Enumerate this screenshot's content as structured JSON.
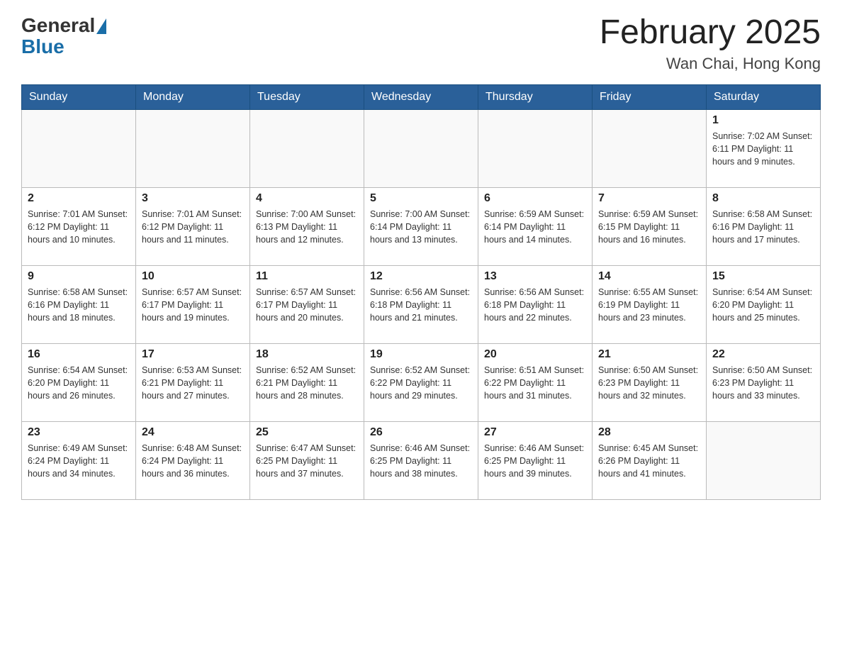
{
  "logo": {
    "general": "General",
    "blue": "Blue"
  },
  "title": "February 2025",
  "location": "Wan Chai, Hong Kong",
  "weekdays": [
    "Sunday",
    "Monday",
    "Tuesday",
    "Wednesday",
    "Thursday",
    "Friday",
    "Saturday"
  ],
  "weeks": [
    [
      {
        "day": "",
        "info": ""
      },
      {
        "day": "",
        "info": ""
      },
      {
        "day": "",
        "info": ""
      },
      {
        "day": "",
        "info": ""
      },
      {
        "day": "",
        "info": ""
      },
      {
        "day": "",
        "info": ""
      },
      {
        "day": "1",
        "info": "Sunrise: 7:02 AM\nSunset: 6:11 PM\nDaylight: 11 hours\nand 9 minutes."
      }
    ],
    [
      {
        "day": "2",
        "info": "Sunrise: 7:01 AM\nSunset: 6:12 PM\nDaylight: 11 hours\nand 10 minutes."
      },
      {
        "day": "3",
        "info": "Sunrise: 7:01 AM\nSunset: 6:12 PM\nDaylight: 11 hours\nand 11 minutes."
      },
      {
        "day": "4",
        "info": "Sunrise: 7:00 AM\nSunset: 6:13 PM\nDaylight: 11 hours\nand 12 minutes."
      },
      {
        "day": "5",
        "info": "Sunrise: 7:00 AM\nSunset: 6:14 PM\nDaylight: 11 hours\nand 13 minutes."
      },
      {
        "day": "6",
        "info": "Sunrise: 6:59 AM\nSunset: 6:14 PM\nDaylight: 11 hours\nand 14 minutes."
      },
      {
        "day": "7",
        "info": "Sunrise: 6:59 AM\nSunset: 6:15 PM\nDaylight: 11 hours\nand 16 minutes."
      },
      {
        "day": "8",
        "info": "Sunrise: 6:58 AM\nSunset: 6:16 PM\nDaylight: 11 hours\nand 17 minutes."
      }
    ],
    [
      {
        "day": "9",
        "info": "Sunrise: 6:58 AM\nSunset: 6:16 PM\nDaylight: 11 hours\nand 18 minutes."
      },
      {
        "day": "10",
        "info": "Sunrise: 6:57 AM\nSunset: 6:17 PM\nDaylight: 11 hours\nand 19 minutes."
      },
      {
        "day": "11",
        "info": "Sunrise: 6:57 AM\nSunset: 6:17 PM\nDaylight: 11 hours\nand 20 minutes."
      },
      {
        "day": "12",
        "info": "Sunrise: 6:56 AM\nSunset: 6:18 PM\nDaylight: 11 hours\nand 21 minutes."
      },
      {
        "day": "13",
        "info": "Sunrise: 6:56 AM\nSunset: 6:18 PM\nDaylight: 11 hours\nand 22 minutes."
      },
      {
        "day": "14",
        "info": "Sunrise: 6:55 AM\nSunset: 6:19 PM\nDaylight: 11 hours\nand 23 minutes."
      },
      {
        "day": "15",
        "info": "Sunrise: 6:54 AM\nSunset: 6:20 PM\nDaylight: 11 hours\nand 25 minutes."
      }
    ],
    [
      {
        "day": "16",
        "info": "Sunrise: 6:54 AM\nSunset: 6:20 PM\nDaylight: 11 hours\nand 26 minutes."
      },
      {
        "day": "17",
        "info": "Sunrise: 6:53 AM\nSunset: 6:21 PM\nDaylight: 11 hours\nand 27 minutes."
      },
      {
        "day": "18",
        "info": "Sunrise: 6:52 AM\nSunset: 6:21 PM\nDaylight: 11 hours\nand 28 minutes."
      },
      {
        "day": "19",
        "info": "Sunrise: 6:52 AM\nSunset: 6:22 PM\nDaylight: 11 hours\nand 29 minutes."
      },
      {
        "day": "20",
        "info": "Sunrise: 6:51 AM\nSunset: 6:22 PM\nDaylight: 11 hours\nand 31 minutes."
      },
      {
        "day": "21",
        "info": "Sunrise: 6:50 AM\nSunset: 6:23 PM\nDaylight: 11 hours\nand 32 minutes."
      },
      {
        "day": "22",
        "info": "Sunrise: 6:50 AM\nSunset: 6:23 PM\nDaylight: 11 hours\nand 33 minutes."
      }
    ],
    [
      {
        "day": "23",
        "info": "Sunrise: 6:49 AM\nSunset: 6:24 PM\nDaylight: 11 hours\nand 34 minutes."
      },
      {
        "day": "24",
        "info": "Sunrise: 6:48 AM\nSunset: 6:24 PM\nDaylight: 11 hours\nand 36 minutes."
      },
      {
        "day": "25",
        "info": "Sunrise: 6:47 AM\nSunset: 6:25 PM\nDaylight: 11 hours\nand 37 minutes."
      },
      {
        "day": "26",
        "info": "Sunrise: 6:46 AM\nSunset: 6:25 PM\nDaylight: 11 hours\nand 38 minutes."
      },
      {
        "day": "27",
        "info": "Sunrise: 6:46 AM\nSunset: 6:25 PM\nDaylight: 11 hours\nand 39 minutes."
      },
      {
        "day": "28",
        "info": "Sunrise: 6:45 AM\nSunset: 6:26 PM\nDaylight: 11 hours\nand 41 minutes."
      },
      {
        "day": "",
        "info": ""
      }
    ]
  ]
}
